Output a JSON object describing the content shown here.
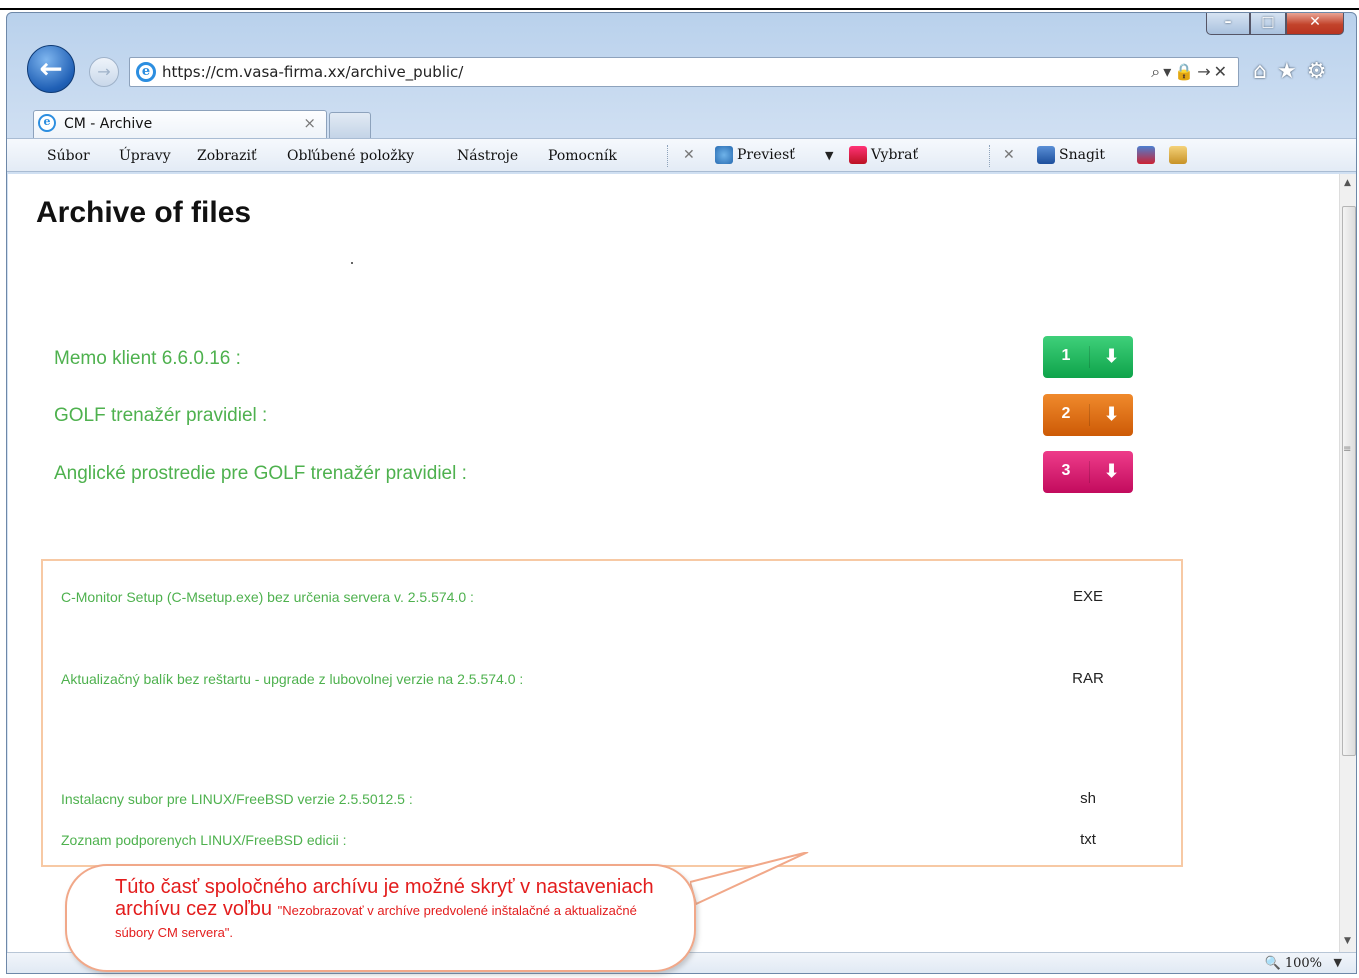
{
  "browser": {
    "url": "https://cm.vasa-firma.xx/archive_public/",
    "tab_title": "CM - Archive",
    "tab_close": "×",
    "zoom": "100%",
    "menu": [
      "Súbor",
      "Úpravy",
      "Zobraziť",
      "Obľúbené položky",
      "Nástroje",
      "Pomocník"
    ],
    "commands": {
      "translate": "Previesť",
      "select": "Vybrať",
      "snagit": "Snagit"
    }
  },
  "page": {
    "title": "Archive of files",
    "downloads": [
      {
        "label": "Memo klient 6.6.0.16 :",
        "number": "1",
        "color": "#14b455"
      },
      {
        "label": "GOLF trenažér pravidiel :",
        "number": "2",
        "color": "#e06d12"
      },
      {
        "label": "Anglické prostredie pre GOLF trenažér pravidiel :",
        "number": "3",
        "color": "#d51971"
      }
    ],
    "cm_files": [
      {
        "label": "C-Monitor Setup (C-Msetup.exe) bez určenia servera v. 2.5.574.0 :",
        "type": "EXE"
      },
      {
        "label": "Aktualizačný balík bez reštartu - upgrade z lubovolnej verzie na 2.5.574.0 :",
        "type": "RAR"
      },
      {
        "label": "Instalacny subor pre LINUX/FreeBSD verzie 2.5.5012.5 :",
        "type": "sh"
      },
      {
        "label": "Zoznam podporenych LINUX/FreeBSD edicii :",
        "type": "txt"
      }
    ]
  },
  "callout": {
    "line_large": "Túto časť spoločného archívu je možné skryť v nastaveniach archívu cez voľbu",
    "line_small": "\"Nezobrazovať v archíve predvolené inštalačné a aktualizačné súbory CM servera\"."
  }
}
